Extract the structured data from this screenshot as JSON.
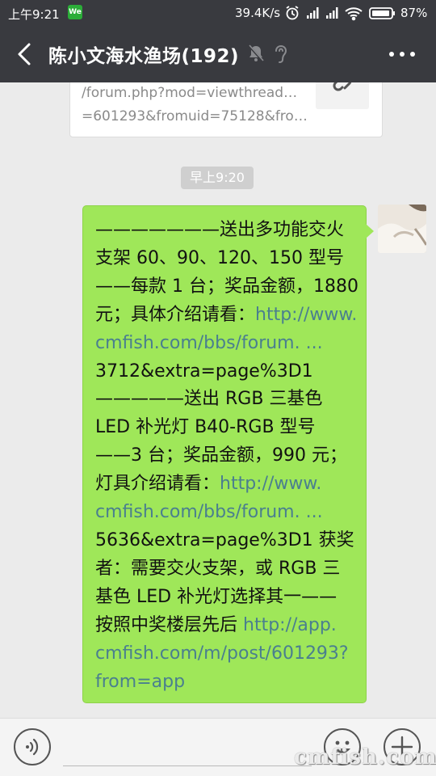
{
  "status_bar": {
    "time": "上午9:21",
    "app_badge": "We",
    "network_speed": "39.4K/s",
    "battery": "87%"
  },
  "title_bar": {
    "chat_name": "陈小文海水渔场(192)"
  },
  "link_card": {
    "url_line1": "/forum.php?mod=viewthread&tid",
    "url_line2": "=601293&fromuid=75128&from..."
  },
  "timestamp": "早上9:20",
  "message": {
    "lines": [
      "———————送出多功能交火",
      "支架 60、90、120、150 型号",
      "——每款 1 台；奖品金额，1880",
      "元；具体介绍请看：",
      "3712&extra=page%3D1",
      "—————送出 RGB 三基色",
      "LED 补光灯 B40-RGB 型号",
      "——3 台；奖品金额，990 元；",
      "灯具介绍请看：",
      "5636&extra=page%3D1 获奖",
      "者：需要交火支架，或 RGB 三",
      "基色 LED 补光灯选择其一——",
      "按照中奖楼层先后 "
    ],
    "links": [
      "http://www.",
      "cmfish.com/bbs/forum. ...",
      "http://www.",
      "cmfish.com/bbs/forum. ...",
      "http://app.",
      "cmfish.com/m/post/601293?",
      "from=app"
    ]
  },
  "watermark": "cmfish.com",
  "colors": {
    "header_bg": "#393a3f",
    "bubble_bg": "#9fe759",
    "link_color": "#4a7f8f",
    "chat_bg": "#ebebeb"
  },
  "icons": [
    "back-arrow-icon",
    "mute-bell-icon",
    "earpiece-icon",
    "more-icon",
    "voice-icon",
    "emoji-icon",
    "plus-icon"
  ]
}
